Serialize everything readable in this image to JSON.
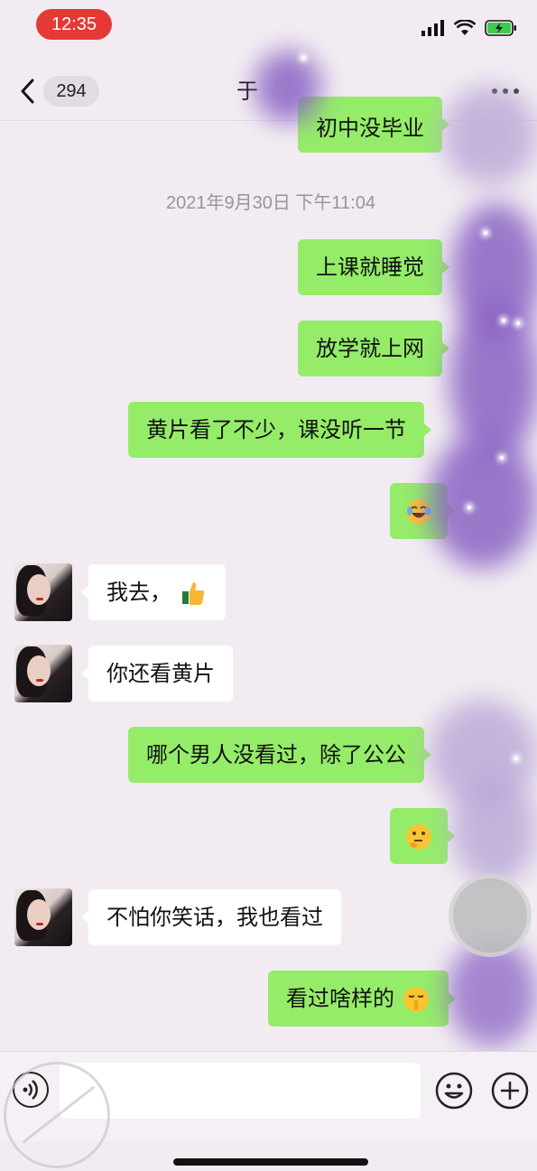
{
  "status_bar": {
    "time": "12:35",
    "icons": [
      "signal-icon",
      "wifi-icon",
      "battery-charging-icon"
    ]
  },
  "nav": {
    "unread_count": "294",
    "title": "于"
  },
  "messages": {
    "partial_top": "初中没毕业",
    "timestamp": "2021年9月30日 下午11:04",
    "m1": "上课就睡觉",
    "m2": "放学就上网",
    "m3": "黄片看了不少，课没听一节",
    "m5": "我去，",
    "m6": "你还看黄片",
    "m7": "哪个男人没看过，除了公公",
    "m9": "不怕你笑话，我也看过",
    "m10": "看过啥样的"
  },
  "emoji_names": {
    "m4": "laughing-crying-face-icon",
    "m5": "thumbs-up-icon",
    "m8": "thinking-face-icon",
    "m10": "shushing-face-icon"
  },
  "colors": {
    "outgoing_bubble": "#95ec69",
    "incoming_bubble": "#ffffff",
    "time_pill": "#e53935",
    "background": "#f2ecf2"
  }
}
